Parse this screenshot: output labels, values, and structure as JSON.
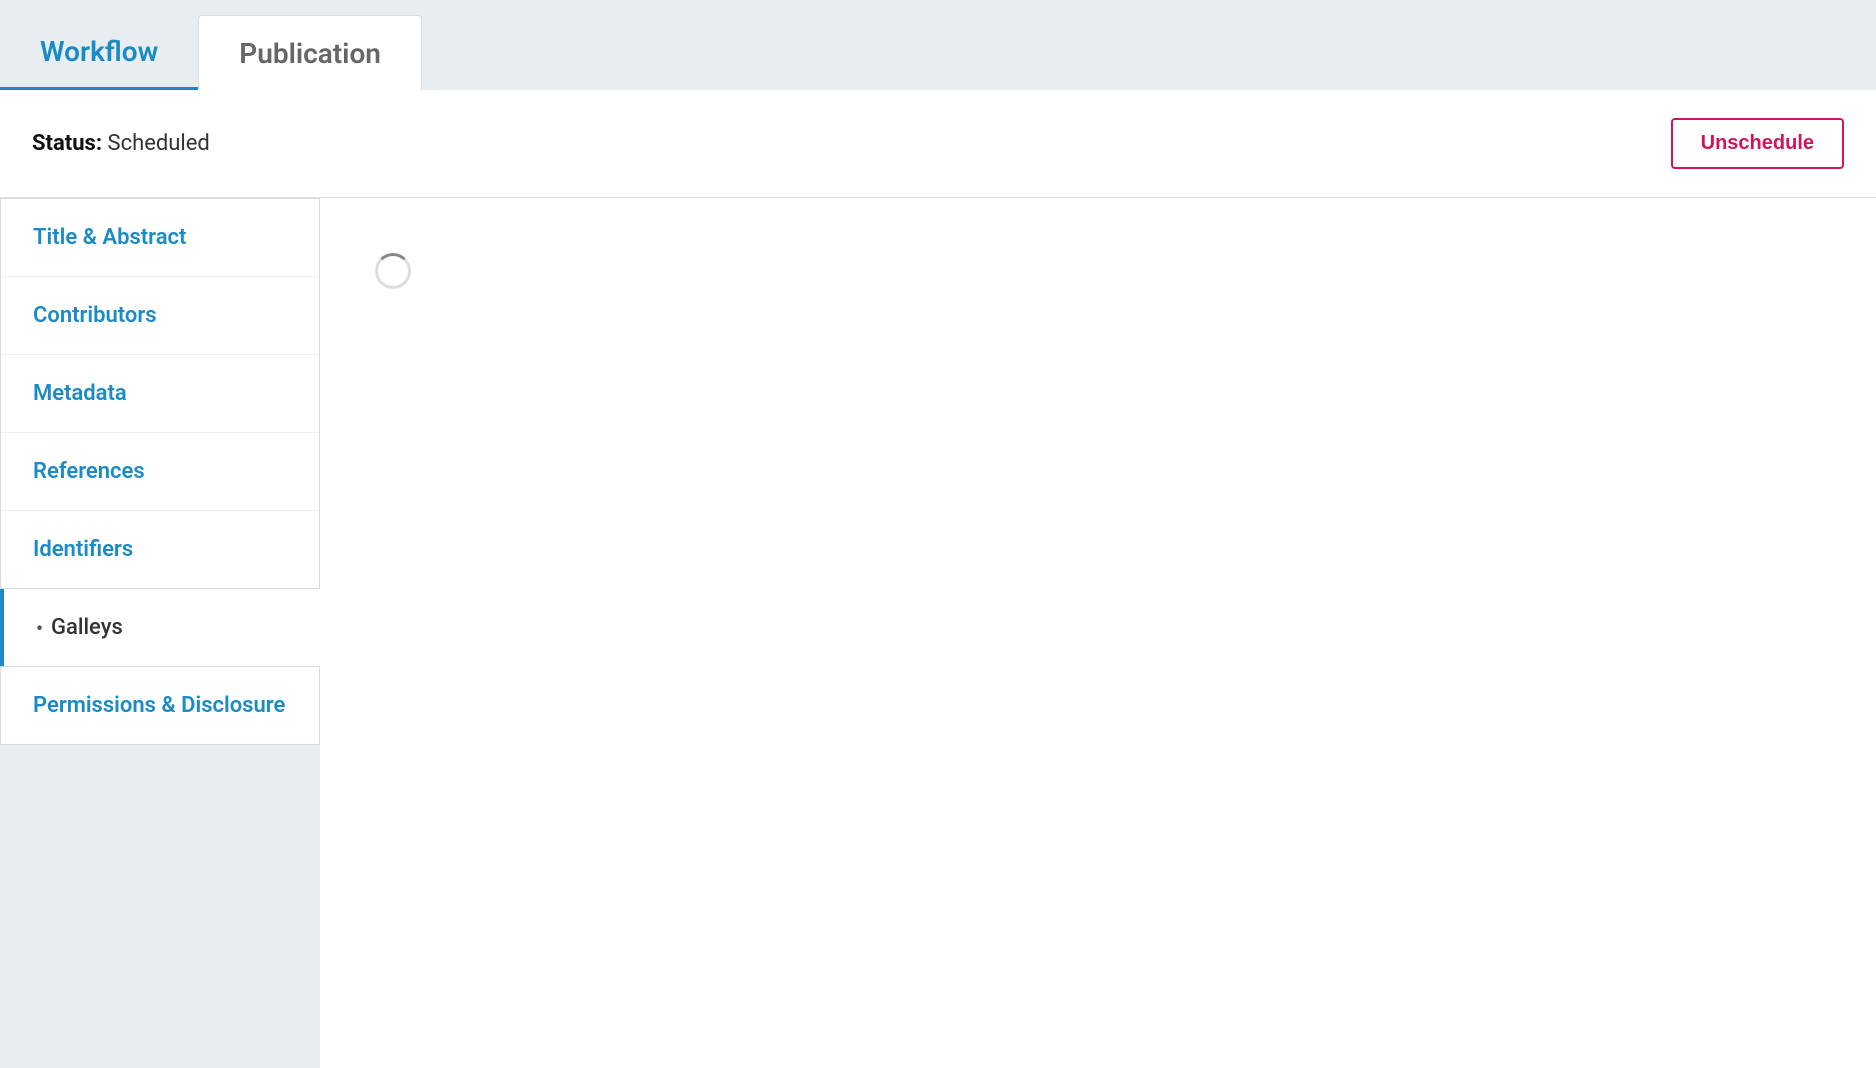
{
  "tabs": [
    {
      "id": "workflow",
      "label": "Workflow",
      "active": true
    },
    {
      "id": "publication",
      "label": "Publication",
      "active": false
    }
  ],
  "status": {
    "label": "Status:",
    "value": "Scheduled"
  },
  "unschedule_button": "Unschedule",
  "sidebar": {
    "sections": [
      {
        "items": [
          {
            "id": "title-abstract",
            "label": "Title & Abstract"
          },
          {
            "id": "contributors",
            "label": "Contributors"
          },
          {
            "id": "metadata",
            "label": "Metadata"
          },
          {
            "id": "references",
            "label": "References"
          },
          {
            "id": "identifiers",
            "label": "Identifiers"
          }
        ]
      }
    ],
    "galleys": {
      "label": "Galleys",
      "dot": "•"
    },
    "bottom_items": [
      {
        "id": "permissions-disclosure",
        "label": "Permissions & Disclosure"
      }
    ]
  }
}
